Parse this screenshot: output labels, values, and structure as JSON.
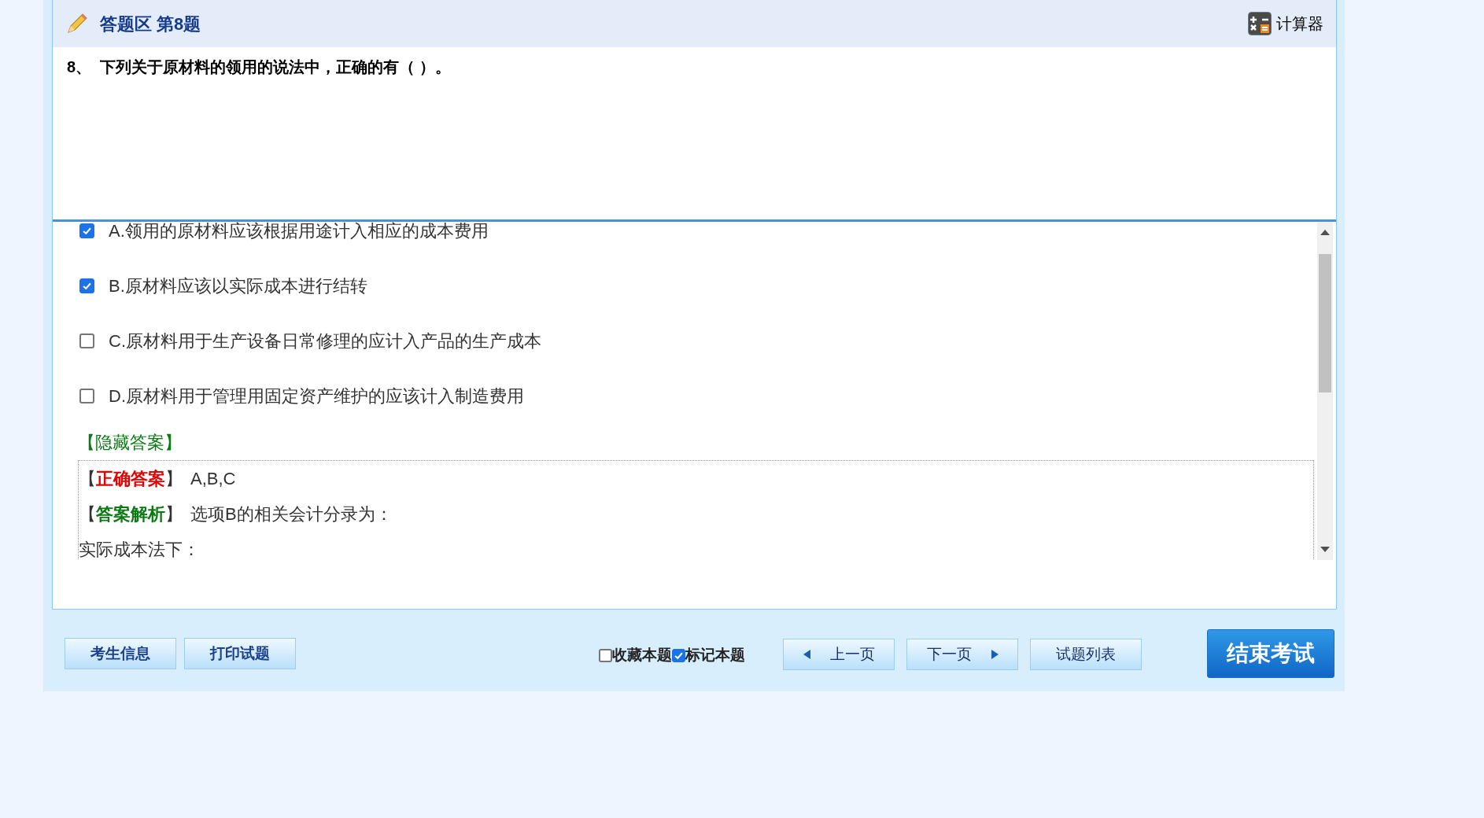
{
  "header": {
    "title": "答题区 第8题",
    "calculator": "计算器"
  },
  "question": {
    "number": "8、",
    "text": "下列关于原材料的领用的说法中，正确的有（ ）。"
  },
  "options": [
    {
      "text": "A.领用的原材料应该根据用途计入相应的成本费用",
      "checked": true
    },
    {
      "text": "B.原材料应该以实际成本进行结转",
      "checked": true
    },
    {
      "text": "C.原材料用于生产设备日常修理的应计入产品的生产成本",
      "checked": false
    },
    {
      "text": "D.原材料用于管理用固定资产维护的应该计入制造费用",
      "checked": false
    }
  ],
  "answer": {
    "toggle": "【隐藏答案】",
    "correct_label": "【**正确答案**】",
    "correct_value": "A,B,C",
    "analysis_label": "【**答案解析**】",
    "analysis_text": "选项B的相关会计分录为：",
    "line": "实际成本法下："
  },
  "footer": {
    "left_buttons": [
      "考生信息",
      "打印试题"
    ],
    "checkboxes": [
      {
        "label": "收藏本题",
        "checked": false
      },
      {
        "label": "标记本题",
        "checked": true
      }
    ],
    "nav_buttons": [
      {
        "kind": "prev",
        "label": "上一页"
      },
      {
        "kind": "next",
        "label": "下一页"
      },
      {
        "kind": "list",
        "label": "试题列表"
      }
    ],
    "end_button": "结束考试"
  }
}
